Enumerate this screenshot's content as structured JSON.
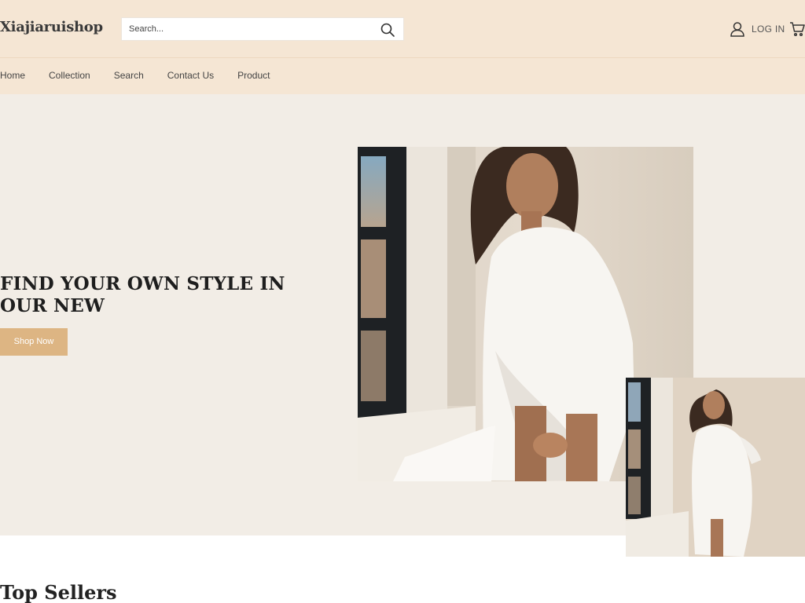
{
  "header": {
    "brand": "Xiajiaruishop",
    "search": {
      "placeholder": "Search...",
      "icon": "search-icon"
    },
    "login_label": "LOG IN",
    "icons": {
      "account": "user-icon",
      "cart": "cart-icon"
    }
  },
  "nav": {
    "items": [
      {
        "label": "Home"
      },
      {
        "label": "Collection"
      },
      {
        "label": "Search"
      },
      {
        "label": "Contact Us"
      },
      {
        "label": "Product"
      }
    ]
  },
  "hero": {
    "title": "FIND YOUR OWN STYLE IN OUR NEW",
    "button_label": "Shop Now"
  },
  "sections": {
    "top_sellers_title": "Top Sellers"
  },
  "colors": {
    "header_bg": "#f5e6d4",
    "hero_bg": "#f2ede6",
    "button_bg": "#ddb583",
    "page_bg": "#ffffff"
  }
}
